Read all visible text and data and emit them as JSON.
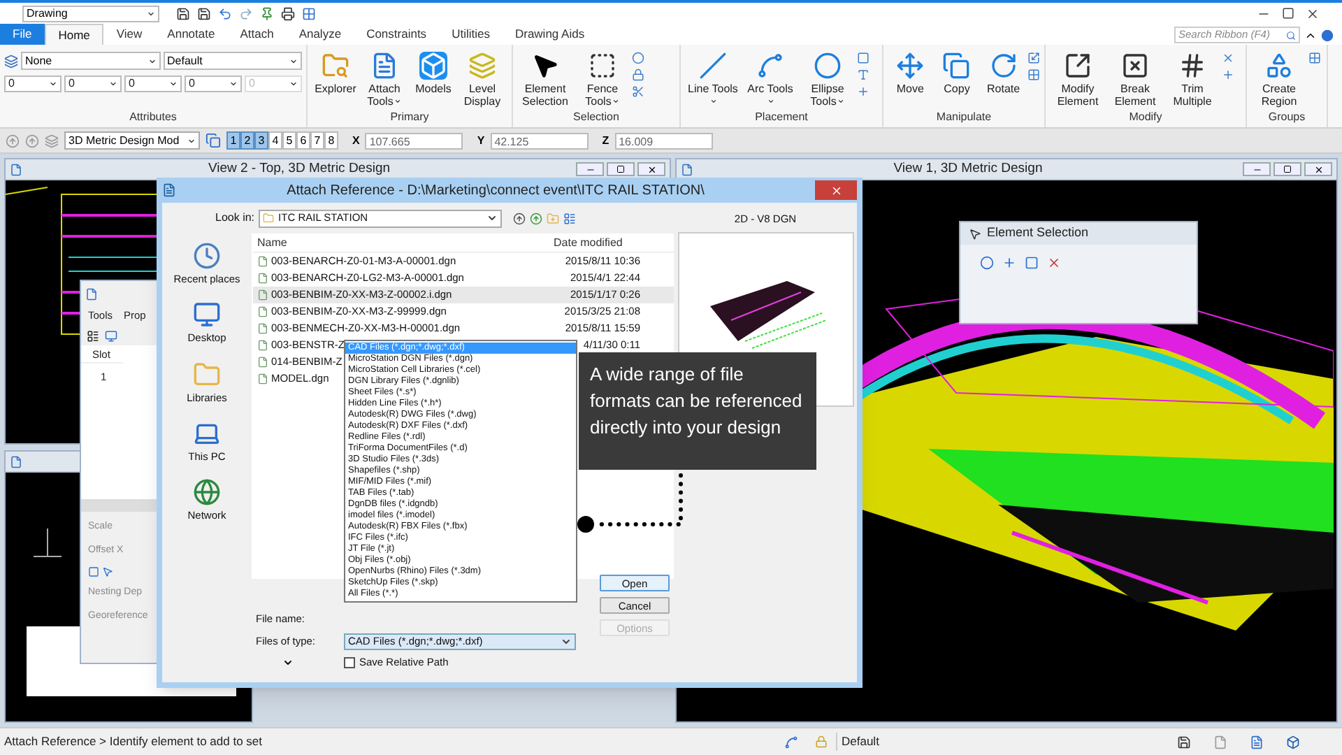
{
  "quick_access": {
    "workflow": "Drawing"
  },
  "ribbon": {
    "tabs": [
      {
        "label": "File",
        "kind": "file",
        "selected": false
      },
      {
        "label": "Home",
        "kind": "tab",
        "selected": true
      },
      {
        "label": "View",
        "kind": "tab",
        "selected": false
      },
      {
        "label": "Annotate",
        "kind": "tab",
        "selected": false
      },
      {
        "label": "Attach",
        "kind": "tab",
        "selected": false
      },
      {
        "label": "Analyze",
        "kind": "tab",
        "selected": false
      },
      {
        "label": "Constraints",
        "kind": "tab",
        "selected": false
      },
      {
        "label": "Utilities",
        "kind": "tab",
        "selected": false
      },
      {
        "label": "Drawing Aids",
        "kind": "tab",
        "selected": false
      }
    ],
    "search": {
      "placeholder": "Search Ribbon (F4)"
    },
    "attributes": {
      "label": "Attributes",
      "dropdowns": [
        "None",
        "Default"
      ],
      "small_dropdowns": [
        {
          "value": "0",
          "disabled": false
        },
        {
          "value": "0",
          "disabled": false
        },
        {
          "value": "0",
          "disabled": false
        },
        {
          "value": "0",
          "disabled": false
        },
        {
          "value": "0",
          "disabled": true
        }
      ]
    },
    "groups": [
      {
        "label": "Primary",
        "buttons": [
          {
            "label": "Explorer",
            "menu": false
          },
          {
            "label": "Attach Tools",
            "menu": true
          },
          {
            "label": "Models",
            "menu": false
          },
          {
            "label": "Level Display",
            "menu": false
          }
        ]
      },
      {
        "label": "Selection",
        "buttons": [
          {
            "label": "Element Selection",
            "menu": false
          },
          {
            "label": "Fence Tools",
            "menu": true
          }
        ]
      },
      {
        "label": "Placement",
        "buttons": [
          {
            "label": "Line Tools",
            "menu": true
          },
          {
            "label": "Arc Tools",
            "menu": true
          },
          {
            "label": "Ellipse Tools",
            "menu": true
          }
        ]
      },
      {
        "label": "Manipulate",
        "buttons": [
          {
            "label": "Move",
            "menu": false
          },
          {
            "label": "Copy",
            "menu": false
          },
          {
            "label": "Rotate",
            "menu": false
          }
        ]
      },
      {
        "label": "Modify",
        "buttons": [
          {
            "label": "Modify Element",
            "menu": false
          },
          {
            "label": "Break Element",
            "menu": false
          },
          {
            "label": "Trim Multiple",
            "menu": false
          }
        ]
      },
      {
        "label": "Groups",
        "buttons": [
          {
            "label": "Create Region",
            "menu": false
          }
        ]
      }
    ]
  },
  "toolbar": {
    "model": "3D Metric Design Mod",
    "view_buttons": [
      {
        "label": "1",
        "on": true
      },
      {
        "label": "2",
        "on": true
      },
      {
        "label": "3",
        "on": true
      },
      {
        "label": "4",
        "on": false
      },
      {
        "label": "5",
        "on": false
      },
      {
        "label": "6",
        "on": false
      },
      {
        "label": "7",
        "on": false
      },
      {
        "label": "8",
        "on": false
      }
    ],
    "coordinates": [
      {
        "axis": "X",
        "value": "107.665"
      },
      {
        "axis": "Y",
        "value": "42.125"
      },
      {
        "axis": "Z",
        "value": "16.009"
      }
    ]
  },
  "views": [
    {
      "title": "View 2 - Top, 3D Metric Design"
    },
    {
      "title": "View 1, 3D Metric Design"
    }
  ],
  "references_window": {
    "menu": [
      "Tools",
      "Prop"
    ],
    "column": "Slot",
    "row": "1",
    "fields": [
      "Scale",
      "Offset X",
      "Nesting Dep",
      "Georeference"
    ]
  },
  "element_selection": {
    "title": "Element Selection"
  },
  "dialog": {
    "title": "Attach Reference - D:\\Marketing\\connect event\\ITC RAIL STATION\\",
    "look_in_label": "Look in:",
    "look_in": "ITC RAIL STATION",
    "places": [
      "Recent places",
      "Desktop",
      "Libraries",
      "This PC",
      "Network"
    ],
    "columns": [
      "Name",
      "Date modified"
    ],
    "files": [
      {
        "name": "003-BENARCH-Z0-01-M3-A-00001.dgn",
        "date": "2015/8/11 10:36",
        "selected": false
      },
      {
        "name": "003-BENARCH-Z0-LG2-M3-A-00001.dgn",
        "date": "2015/4/1 22:44",
        "selected": false
      },
      {
        "name": "003-BENBIM-Z0-XX-M3-Z-00002.i.dgn",
        "date": "2015/1/17 0:26",
        "selected": true
      },
      {
        "name": "003-BENBIM-Z0-XX-M3-Z-99999.dgn",
        "date": "2015/3/25 21:08",
        "selected": false
      },
      {
        "name": "003-BENMECH-Z0-XX-M3-H-00001.dgn",
        "date": "2015/8/11 15:59",
        "selected": false
      },
      {
        "name": "003-BENSTR-Z",
        "date": "4/11/30 0:11",
        "selected": false
      },
      {
        "name": "014-BENBIM-Z",
        "selected": false
      },
      {
        "name": "MODEL.dgn",
        "selected": false
      }
    ],
    "preview_label": "2D - V8 DGN",
    "file_name_label": "File name:",
    "files_of_type_label": "Files of type:",
    "files_of_type": "CAD Files (*.dgn;*.dwg;*.dxf)",
    "type_options": [
      {
        "label": "CAD Files (*.dgn;*.dwg;*.dxf)",
        "selected": true
      },
      {
        "label": "MicroStation DGN Files (*.dgn)",
        "selected": false
      },
      {
        "label": "MicroStation Cell Libraries (*.cel)",
        "selected": false
      },
      {
        "label": "DGN Library Files (*.dgnlib)",
        "selected": false
      },
      {
        "label": "Sheet Files (*.s*)",
        "selected": false
      },
      {
        "label": "Hidden Line Files (*.h*)",
        "selected": false
      },
      {
        "label": "Autodesk(R) DWG Files (*.dwg)",
        "selected": false
      },
      {
        "label": "Autodesk(R) DXF Files (*.dxf)",
        "selected": false
      },
      {
        "label": "Redline Files (*.rdl)",
        "selected": false
      },
      {
        "label": "TriForma DocumentFiles (*.d)",
        "selected": false
      },
      {
        "label": "3D Studio Files (*.3ds)",
        "selected": false
      },
      {
        "label": "Shapefiles (*.shp)",
        "selected": false
      },
      {
        "label": "MIF/MID Files (*.mif)",
        "selected": false
      },
      {
        "label": "TAB Files (*.tab)",
        "selected": false
      },
      {
        "label": "DgnDB files (*.idgndb)",
        "selected": false
      },
      {
        "label": "imodel files (*.imodel)",
        "selected": false
      },
      {
        "label": "Autodesk(R) FBX Files (*.fbx)",
        "selected": false
      },
      {
        "label": "IFC Files (*.ifc)",
        "selected": false
      },
      {
        "label": "JT File (*.jt)",
        "selected": false
      },
      {
        "label": "Obj Files (*.obj)",
        "selected": false
      },
      {
        "label": "OpenNurbs (Rhino) Files (*.3dm)",
        "selected": false
      },
      {
        "label": "SketchUp Files (*.skp)",
        "selected": false
      },
      {
        "label": "All Files (*.*)",
        "selected": false
      }
    ],
    "buttons": [
      {
        "label": "Open",
        "disabled": false
      },
      {
        "label": "Cancel",
        "disabled": false
      },
      {
        "label": "Options",
        "disabled": true
      }
    ],
    "save_relative": {
      "label": "Save Relative Path",
      "checked": false
    }
  },
  "callout": {
    "text": "A wide range of file formats can be referenced directly into your design"
  },
  "status_bar": {
    "message": "Attach Reference > Identify element to add to set",
    "level_name": "Default"
  }
}
